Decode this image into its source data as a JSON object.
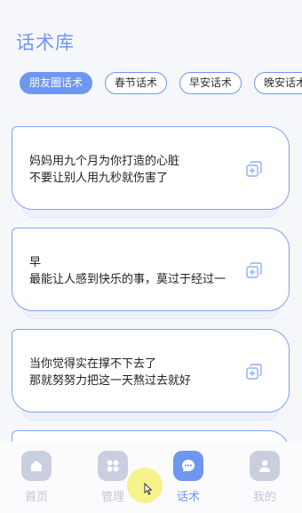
{
  "page": {
    "title": "话术库"
  },
  "tabs": [
    {
      "label": "朋友圈话术",
      "active": true
    },
    {
      "label": "春节话术",
      "active": false
    },
    {
      "label": "早安话术",
      "active": false
    },
    {
      "label": "晚安话术",
      "active": false
    }
  ],
  "cards": [
    {
      "line1": "妈妈用九个月为你打造的心脏",
      "line2": "不要让别人用九秒就伤害了",
      "icon": "copy-icon"
    },
    {
      "line1": "早",
      "line2": "最能让人感到快乐的事，莫过于经过一",
      "icon": "copy-icon"
    },
    {
      "line1": "当你觉得实在撑不下去了",
      "line2": "那就努努力把这一天熬过去就好",
      "icon": "copy-icon"
    }
  ],
  "nav": [
    {
      "label": "首页",
      "icon": "home-icon",
      "active": false
    },
    {
      "label": "管理",
      "icon": "grid-icon",
      "active": false
    },
    {
      "label": "话术",
      "icon": "chat-icon",
      "active": true
    },
    {
      "label": "我的",
      "icon": "user-icon",
      "active": false
    }
  ],
  "colors": {
    "accent": "#6f97ef",
    "inactive": "#c9cfdf",
    "background": "#f6f7fb"
  }
}
